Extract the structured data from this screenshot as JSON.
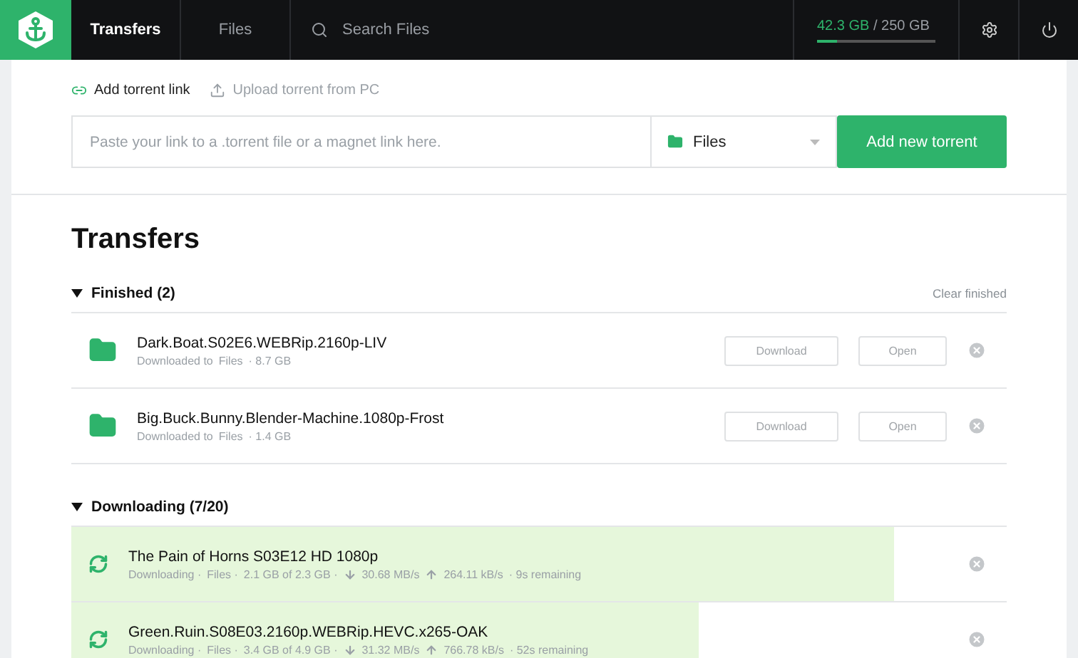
{
  "header": {
    "nav": [
      {
        "label": "Transfers",
        "selected": true
      },
      {
        "label": "Files",
        "selected": false
      }
    ],
    "search": {
      "placeholder": "Search Files"
    },
    "storage": {
      "used": "42.3 GB",
      "total": "/ 250 GB",
      "level": 0.17
    }
  },
  "add_torrent": {
    "tabs": [
      {
        "label": "Add torrent link",
        "selected": true
      },
      {
        "label": "Upload torrent from PC",
        "selected": false
      }
    ],
    "link_field": {
      "placeholder": "Paste your link to a .torrent file or a magnet link here."
    },
    "folder_select": {
      "value": "Files"
    },
    "submit": "Add new torrent"
  },
  "title": "Transfers",
  "sections": [
    {
      "heading": "Finished (2)",
      "expanded": true,
      "action": "Clear finished",
      "items": [
        {
          "kind": "finished",
          "name": "Dark.Boat.S02E6.WEBRip.2160p-LIV",
          "status": "Downloaded to",
          "folder": "Files",
          "size": "· 8.7 GB",
          "buttons": [
            "Download",
            "Open"
          ]
        },
        {
          "kind": "finished",
          "name": "Big.Buck.Bunny.Blender-Machine.1080p-Frost",
          "status": "Downloaded to",
          "folder": "Files",
          "size": "· 1.4 GB",
          "buttons": [
            "Download",
            "Open"
          ]
        }
      ]
    },
    {
      "heading": "Downloading (7/20)",
      "expanded": true,
      "items": [
        {
          "kind": "downloading",
          "name": "The Pain of Horns S03E12 HD 1080p",
          "level": 0.88,
          "status": "Downloading ·",
          "folder": "Files ·",
          "amount": "2.1 GB of 2.3 GB ·",
          "down": "30.68 MB/s",
          "up": "264.11 kB/s",
          "remaining": "· 9s remaining"
        },
        {
          "kind": "downloading",
          "name": "Green.Ruin.S08E03.2160p.WEBRip.HEVC.x265-OAK",
          "level": 0.67,
          "status": "Downloading ·",
          "folder": "Files ·",
          "amount": "3.4 GB of 4.9 GB ·",
          "down": "31.32 MB/s",
          "up": "766.78 kB/s",
          "remaining": "· 52s remaining"
        }
      ]
    }
  ]
}
